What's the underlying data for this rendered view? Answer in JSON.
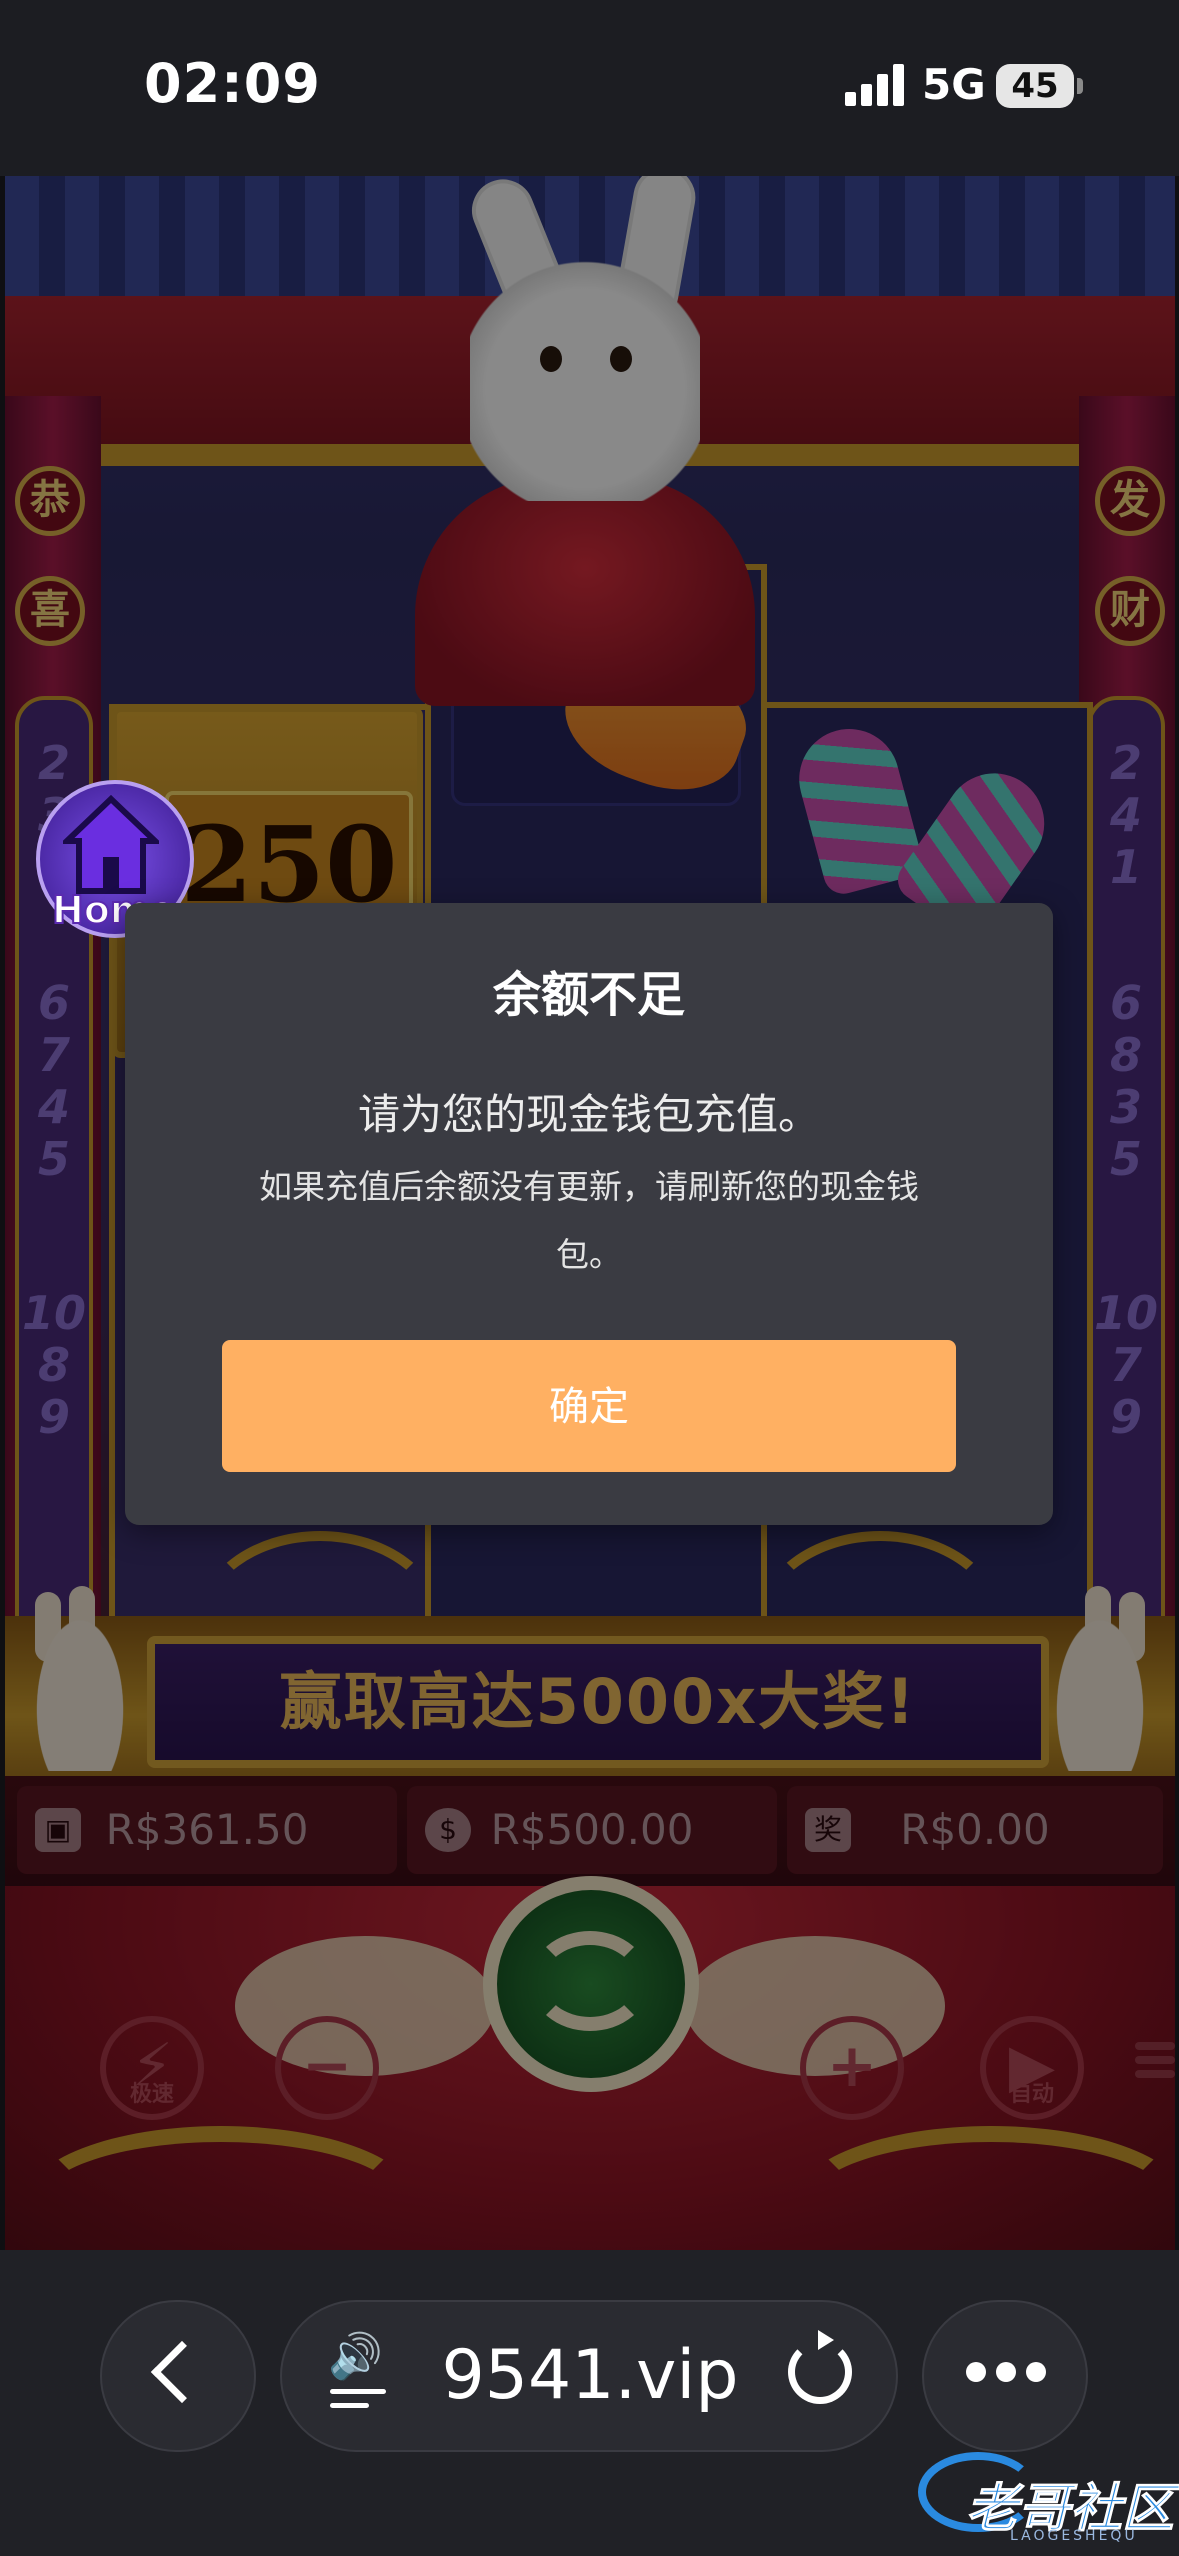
{
  "status_bar": {
    "time": "02:09",
    "network": "5G",
    "battery": "45"
  },
  "game": {
    "multiplier": "250",
    "banner": "赢取高达5000x大奖!",
    "pillar_left": [
      "恭",
      "喜"
    ],
    "pillar_right": [
      "发",
      "财"
    ],
    "pillar_left_numbers": [
      "2",
      "3",
      "4",
      "6",
      "7",
      "4",
      "5",
      "10",
      "8",
      "9"
    ],
    "pillar_right_numbers": [
      "2",
      "4",
      "1",
      "6",
      "8",
      "3",
      "5",
      "10",
      "7",
      "9"
    ],
    "stats": {
      "wallet": "R$361.50",
      "bet": "R$500.00",
      "win": "R$0.00"
    },
    "controls": {
      "turbo_label": "极速",
      "auto_label": "自动",
      "minus": "−",
      "plus": "+"
    },
    "home_label": "Home"
  },
  "modal": {
    "title": "余额不足",
    "message": "请为您的现金钱包充值。",
    "sub_message": "如果充值后余额没有更新，请刷新您的现金钱包。",
    "confirm_label": "确定"
  },
  "browser": {
    "url": "9541.vip"
  },
  "watermark": {
    "text": "老哥社区",
    "sub": "LAOGESHEQU"
  },
  "colors": {
    "confirm_button": "#ffb062",
    "modal_bg": "#3a3b42",
    "audio_icon": "#2f8cff"
  }
}
